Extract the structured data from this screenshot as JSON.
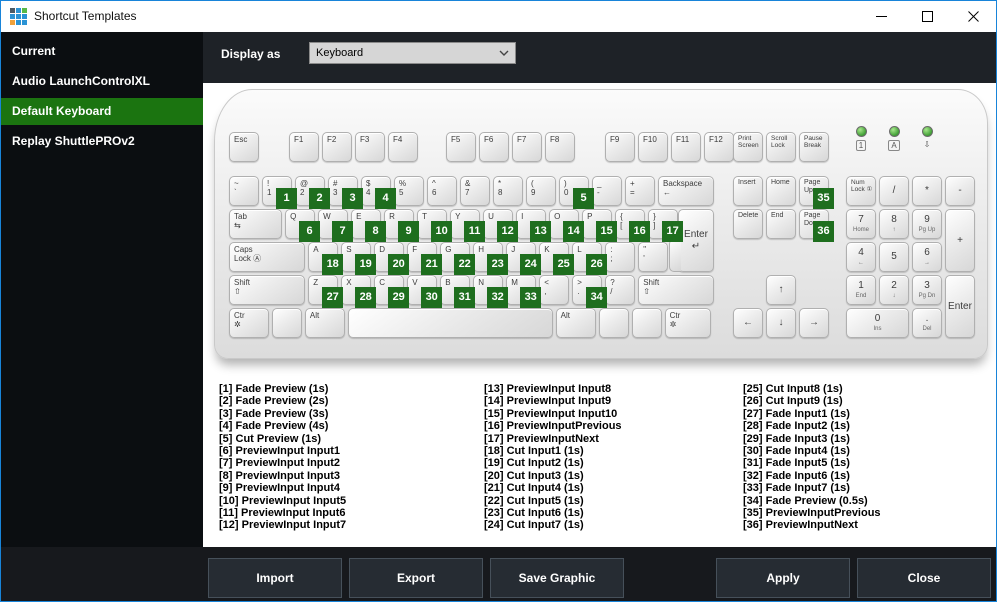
{
  "window": {
    "title": "Shortcut Templates",
    "icon_colors": [
      "#4a5a66",
      "#2a93d5",
      "#57b947",
      "#2a93d5",
      "#2a93d5",
      "#2a93d5",
      "#f0a13a",
      "#2a93d5",
      "#2a93d5"
    ]
  },
  "colors": {
    "window_border": "#1884d9",
    "sidebar_bg": "#0b0e11",
    "sidebar_selected": "#1b7410",
    "header_bg": "#1e2227",
    "footer_bg": "#17191d",
    "button_bg": "#262c33",
    "button_border": "#46505a",
    "badge_green": "#1e6e1e",
    "led_green": "#3f9e35"
  },
  "sidebar": {
    "items": [
      {
        "label": "Current",
        "selected": false
      },
      {
        "label": "Audio LaunchControlXL",
        "selected": false
      },
      {
        "label": "Default Keyboard",
        "selected": true
      },
      {
        "label": "Replay ShuttlePROv2",
        "selected": false
      }
    ]
  },
  "toolbar": {
    "display_as_label": "Display as",
    "display_as_value": "Keyboard"
  },
  "keyboard": {
    "fn_row": [
      {
        "t": "Esc"
      },
      {
        "sp": 24
      },
      {
        "t": "F1"
      },
      {
        "t": "F2"
      },
      {
        "t": "F3"
      },
      {
        "t": "F4"
      },
      {
        "sp": 22
      },
      {
        "t": "F5"
      },
      {
        "t": "F6"
      },
      {
        "t": "F7"
      },
      {
        "t": "F8"
      },
      {
        "sp": 24
      },
      {
        "t": "F9"
      },
      {
        "t": "F10"
      },
      {
        "t": "F11"
      },
      {
        "t": "F12"
      }
    ],
    "rows": [
      [
        {
          "t": "~\n`"
        },
        {
          "t": "!\n1",
          "b": 1
        },
        {
          "t": "@\n2",
          "b": 2
        },
        {
          "t": "#\n3",
          "b": 3
        },
        {
          "t": "$\n4",
          "b": 4
        },
        {
          "t": "%\n5"
        },
        {
          "t": "^\n6"
        },
        {
          "t": "&\n7"
        },
        {
          "t": "*\n8"
        },
        {
          "t": "(\n9"
        },
        {
          "t": ")\n0",
          "b": 5
        },
        {
          "t": "_\n-"
        },
        {
          "t": "+\n="
        },
        {
          "t": "Backspace\n←",
          "w": 1.8,
          "n": "backspace"
        }
      ],
      [
        {
          "t": "Tab\n⇆",
          "w": 1.7
        },
        {
          "t": "Q",
          "b": 6
        },
        {
          "t": "W",
          "b": 7
        },
        {
          "t": "E",
          "b": 8
        },
        {
          "t": "R",
          "b": 9
        },
        {
          "t": "T",
          "b": 10
        },
        {
          "t": "Y",
          "b": 11
        },
        {
          "t": "U",
          "b": 12
        },
        {
          "t": "I",
          "b": 13
        },
        {
          "t": "O",
          "b": 14
        },
        {
          "t": "P",
          "b": 15
        },
        {
          "t": "{\n[",
          "b": 16
        },
        {
          "t": "}\n]",
          "b": 17
        }
      ],
      [
        {
          "t": "Caps\nLock Ⓐ",
          "w": 2.4,
          "n": "caps-lock"
        },
        {
          "t": "A",
          "b": 18
        },
        {
          "t": "S",
          "b": 19
        },
        {
          "t": "D",
          "b": 20
        },
        {
          "t": "F",
          "b": 21
        },
        {
          "t": "G",
          "b": 22
        },
        {
          "t": "H",
          "b": 23
        },
        {
          "t": "J",
          "b": 24
        },
        {
          "t": "K",
          "b": 25
        },
        {
          "t": "L",
          "b": 26
        },
        {
          "t": ":\n;"
        },
        {
          "t": "\"\n'"
        }
      ],
      [
        {
          "t": "Shift\n⇧",
          "w": 2.4
        },
        {
          "t": "Z",
          "b": 27
        },
        {
          "t": "X",
          "b": 28
        },
        {
          "t": "C",
          "b": 29
        },
        {
          "t": "V",
          "b": 30
        },
        {
          "t": "B",
          "b": 31
        },
        {
          "t": "N",
          "b": 32
        },
        {
          "t": "M",
          "b": 33
        },
        {
          "t": "<\n,"
        },
        {
          "t": ">\n.",
          "b": 34
        },
        {
          "t": "?\n/"
        },
        {
          "t": "Shift\n⇧",
          "w": 2.4
        }
      ],
      [
        {
          "t": "Ctr\n✲",
          "w": 1.3
        },
        {
          "t": ""
        },
        {
          "t": "Alt",
          "w": 1.3
        },
        {
          "t": "",
          "w": 6.3,
          "n": "space"
        },
        {
          "t": "Alt",
          "w": 1.3
        },
        {
          "t": ""
        },
        {
          "t": ""
        },
        {
          "t": "Ctr\n✲",
          "w": 1.5
        }
      ]
    ],
    "iso_enter": {
      "t": "Enter\n↵",
      "n": "enter"
    },
    "nav_top": [
      {
        "t": "Print\nScreen"
      },
      {
        "t": "Scroll\nLock"
      },
      {
        "t": "Pause\nBreak"
      }
    ],
    "nav": [
      {
        "t": "Insert",
        "r": 1,
        "c": 1
      },
      {
        "t": "Home",
        "r": 1,
        "c": 2
      },
      {
        "t": "Page\nUp",
        "r": 1,
        "c": 3,
        "b": 35
      },
      {
        "t": "Delete",
        "r": 2,
        "c": 1
      },
      {
        "t": "End",
        "r": 2,
        "c": 2
      },
      {
        "t": "Page\nDown",
        "r": 2,
        "c": 3,
        "b": 36
      },
      {
        "t": "↑",
        "r": 4,
        "c": 2,
        "cls": "np",
        "n": "arrow-up"
      },
      {
        "t": "←",
        "r": 5,
        "c": 1,
        "cls": "np",
        "n": "arrow-left"
      },
      {
        "t": "↓",
        "r": 5,
        "c": 2,
        "cls": "np",
        "n": "arrow-down"
      },
      {
        "t": "→",
        "r": 5,
        "c": 3,
        "cls": "np",
        "n": "arrow-right"
      }
    ],
    "leds": [
      {
        "glyph": "1",
        "boxed": true,
        "n": "num-lock-led"
      },
      {
        "glyph": "A",
        "boxed": true,
        "n": "caps-lock-led"
      },
      {
        "glyph": "⇩",
        "boxed": false,
        "n": "scroll-lock-led"
      }
    ],
    "numpad": [
      {
        "t": "Num\nLock ①",
        "r": 1,
        "c": 1,
        "n": "num-lock"
      },
      {
        "t": "/",
        "r": 1,
        "c": 2,
        "cls": "np",
        "n": "numpad-slash"
      },
      {
        "t": "*",
        "r": 1,
        "c": 3,
        "cls": "np",
        "n": "numpad-star"
      },
      {
        "t": "-",
        "r": 1,
        "c": 4,
        "cls": "np",
        "n": "numpad-minus"
      },
      {
        "t": "7",
        "s": "Home",
        "r": 2,
        "c": 1,
        "cls": "np"
      },
      {
        "t": "8",
        "s": "↑",
        "r": 2,
        "c": 2,
        "cls": "np"
      },
      {
        "t": "9",
        "s": "Pg Up",
        "r": 2,
        "c": 3,
        "cls": "np"
      },
      {
        "t": "+",
        "r": 2,
        "c": 4,
        "h": 2,
        "cls": "np",
        "n": "numpad-plus"
      },
      {
        "t": "4",
        "s": "←",
        "r": 3,
        "c": 1,
        "cls": "np"
      },
      {
        "t": "5",
        "r": 3,
        "c": 2,
        "cls": "np"
      },
      {
        "t": "6",
        "s": "→",
        "r": 3,
        "c": 3,
        "cls": "np"
      },
      {
        "t": "1",
        "s": "End",
        "r": 4,
        "c": 1,
        "cls": "np"
      },
      {
        "t": "2",
        "s": "↓",
        "r": 4,
        "c": 2,
        "cls": "np"
      },
      {
        "t": "3",
        "s": "Pg Dn",
        "r": 4,
        "c": 3,
        "cls": "np"
      },
      {
        "t": "Enter",
        "r": 4,
        "c": 4,
        "h": 2,
        "cls": "np",
        "n": "numpad-enter"
      },
      {
        "t": "0",
        "s": "Ins",
        "r": 5,
        "c": 1,
        "w": 2,
        "cls": "np",
        "n": "numpad-0"
      },
      {
        "t": ".",
        "s": "Del",
        "r": 5,
        "c": 3,
        "cls": "np",
        "n": "numpad-dot"
      }
    ]
  },
  "legend": {
    "columns": [
      [
        "[1] Fade Preview (1s)",
        "[2] Fade Preview (2s)",
        "[3] Fade Preview (3s)",
        "[4] Fade Preview (4s)",
        "[5] Cut Preview (1s)",
        "[6] PreviewInput Input1",
        "[7] PreviewInput Input2",
        "[8] PreviewInput Input3",
        "[9] PreviewInput Input4",
        "[10] PreviewInput Input5",
        "[11] PreviewInput Input6",
        "[12] PreviewInput Input7"
      ],
      [
        "[13] PreviewInput Input8",
        "[14] PreviewInput Input9",
        "[15] PreviewInput Input10",
        "[16] PreviewInputPrevious",
        "[17] PreviewInputNext",
        "[18] Cut Input1 (1s)",
        "[19] Cut Input2 (1s)",
        "[20] Cut Input3 (1s)",
        "[21] Cut Input4 (1s)",
        "[22] Cut Input5 (1s)",
        "[23] Cut Input6 (1s)",
        "[24] Cut Input7 (1s)"
      ],
      [
        "[25] Cut Input8 (1s)",
        "[26] Cut Input9 (1s)",
        "[27] Fade Input1 (1s)",
        "[28] Fade Input2 (1s)",
        "[29] Fade Input3 (1s)",
        "[30] Fade Input4 (1s)",
        "[31] Fade Input5 (1s)",
        "[32] Fade Input6 (1s)",
        "[33] Fade Input7 (1s)",
        "[34] Fade Preview (0.5s)",
        "[35] PreviewInputPrevious",
        "[36] PreviewInputNext"
      ]
    ]
  },
  "footer": {
    "buttons_left": [
      "Import",
      "Export",
      "Save Graphic"
    ],
    "buttons_right": [
      "Apply",
      "Close"
    ]
  }
}
